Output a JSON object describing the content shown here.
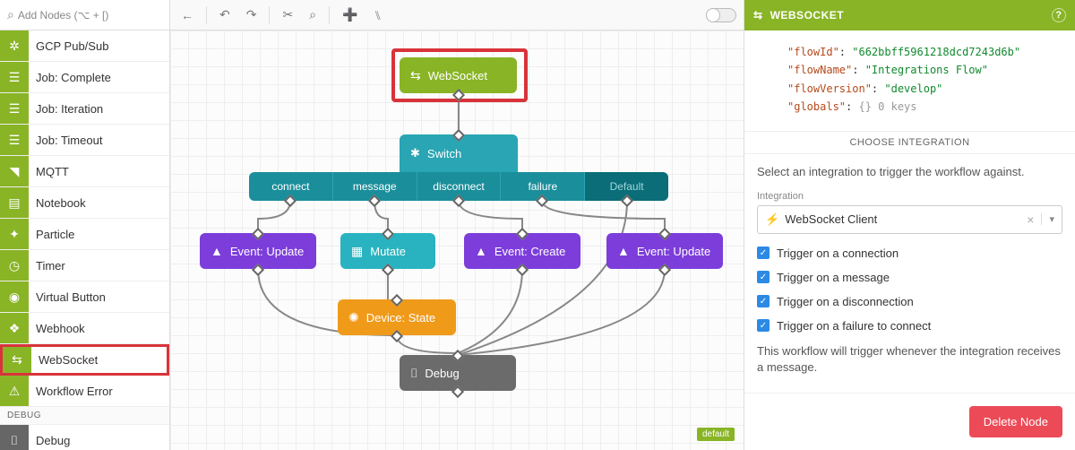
{
  "search": {
    "placeholder": "Add Nodes (⌥ + [)"
  },
  "sidebar": {
    "items": [
      {
        "label": "GCP Pub/Sub"
      },
      {
        "label": "Job: Complete"
      },
      {
        "label": "Job: Iteration"
      },
      {
        "label": "Job: Timeout"
      },
      {
        "label": "MQTT"
      },
      {
        "label": "Notebook"
      },
      {
        "label": "Particle"
      },
      {
        "label": "Timer"
      },
      {
        "label": "Virtual Button"
      },
      {
        "label": "Webhook"
      },
      {
        "label": "WebSocket"
      },
      {
        "label": "Workflow Error"
      }
    ],
    "debug_section": "DEBUG",
    "debug_item": "Debug"
  },
  "canvas": {
    "websocket": "WebSocket",
    "switch": "Switch",
    "branches": [
      "connect",
      "message",
      "disconnect",
      "failure",
      "Default"
    ],
    "event_update": "Event: Update",
    "mutate": "Mutate",
    "event_create": "Event: Create",
    "device_state": "Device: State",
    "debug": "Debug",
    "default_badge": "default"
  },
  "details": {
    "title": "WEBSOCKET",
    "code": {
      "flowId_k": "\"flowId\"",
      "flowId_v": "\"662bbff5961218dcd7243d6b\"",
      "flowName_k": "\"flowName\"",
      "flowName_v": "\"Integrations Flow\"",
      "flowVersion_k": "\"flowVersion\"",
      "flowVersion_v": "\"develop\"",
      "globals_k": "\"globals\"",
      "globals_v": "{}  0 keys"
    },
    "choose": "CHOOSE INTEGRATION",
    "hint": "Select an integration to trigger the workflow against.",
    "int_label": "Integration",
    "int_value": "WebSocket Client",
    "checks": [
      "Trigger on a connection",
      "Trigger on a message",
      "Trigger on a disconnection",
      "Trigger on a failure to connect"
    ],
    "desc": "This workflow will trigger whenever the integration receives a message.",
    "delete": "Delete Node"
  }
}
